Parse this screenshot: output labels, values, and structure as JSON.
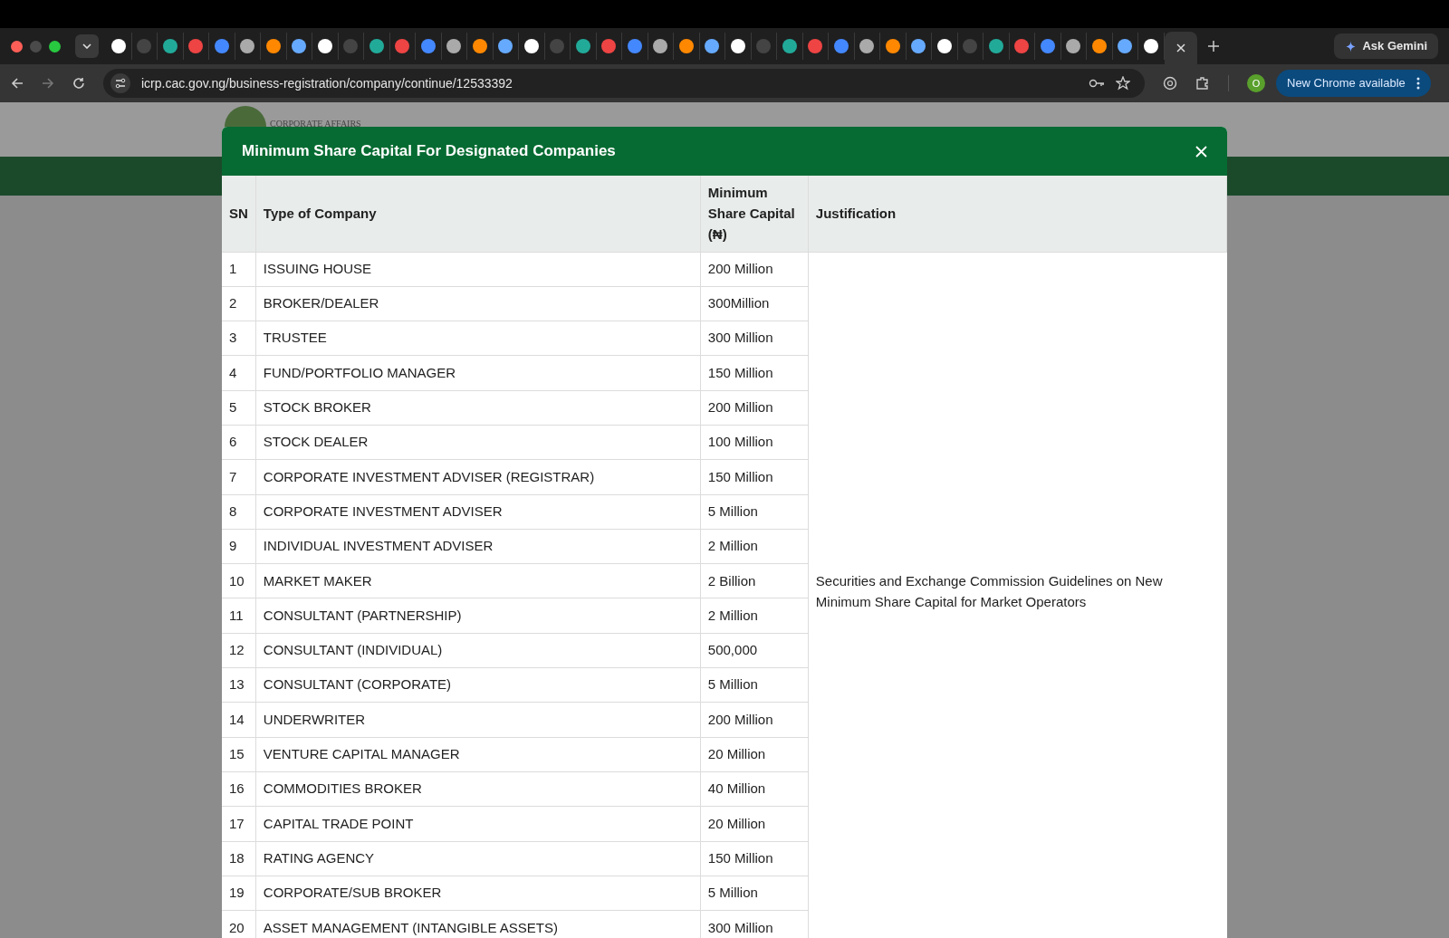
{
  "browser": {
    "ask_button": "Ask Gemini",
    "url": "icrp.cac.gov.ng/business-registration/company/continue/12533392",
    "profile_initial": "O",
    "update_button": "New Chrome available"
  },
  "site": {
    "logo_text": "CORPORATE AFFAIRS"
  },
  "modal": {
    "title": "Minimum Share Capital For Designated Companies",
    "columns": [
      "SN",
      "Type of Company",
      "Minimum Share Capital (₦)",
      "Justification"
    ],
    "justification": "Securities and Exchange Commission Guidelines on New Minimum Share Capital for Market Operators",
    "rows": [
      {
        "sn": "1",
        "type": "ISSUING HOUSE",
        "capital": "200 Million"
      },
      {
        "sn": "2",
        "type": "BROKER/DEALER",
        "capital": "300Million"
      },
      {
        "sn": "3",
        "type": "TRUSTEE",
        "capital": "300 Million"
      },
      {
        "sn": "4",
        "type": "FUND/PORTFOLIO MANAGER",
        "capital": "150 Million"
      },
      {
        "sn": "5",
        "type": "STOCK BROKER",
        "capital": "200 Million"
      },
      {
        "sn": "6",
        "type": "STOCK DEALER",
        "capital": "100 Million"
      },
      {
        "sn": "7",
        "type": "CORPORATE INVESTMENT ADVISER (REGISTRAR)",
        "capital": "150 Million"
      },
      {
        "sn": "8",
        "type": "CORPORATE INVESTMENT ADVISER",
        "capital": "5 Million"
      },
      {
        "sn": "9",
        "type": "INDIVIDUAL INVESTMENT ADVISER",
        "capital": "2 Million"
      },
      {
        "sn": "10",
        "type": "MARKET MAKER",
        "capital": "2 Billion"
      },
      {
        "sn": "11",
        "type": "CONSULTANT (PARTNERSHIP)",
        "capital": "2 Million"
      },
      {
        "sn": "12",
        "type": "CONSULTANT (INDIVIDUAL)",
        "capital": "500,000"
      },
      {
        "sn": "13",
        "type": "CONSULTANT (CORPORATE)",
        "capital": "5 Million"
      },
      {
        "sn": "14",
        "type": "UNDERWRITER",
        "capital": "200 Million"
      },
      {
        "sn": "15",
        "type": "VENTURE CAPITAL MANAGER",
        "capital": "20 Million"
      },
      {
        "sn": "16",
        "type": "COMMODITIES BROKER",
        "capital": "40 Million"
      },
      {
        "sn": "17",
        "type": "CAPITAL TRADE POINT",
        "capital": "20 Million"
      },
      {
        "sn": "18",
        "type": "RATING AGENCY",
        "capital": "150 Million"
      },
      {
        "sn": "19",
        "type": "CORPORATE/SUB BROKER",
        "capital": "5 Million"
      },
      {
        "sn": "20",
        "type": "ASSET MANAGEMENT (INTANGIBLE ASSETS)",
        "capital": "300 Million"
      }
    ]
  }
}
